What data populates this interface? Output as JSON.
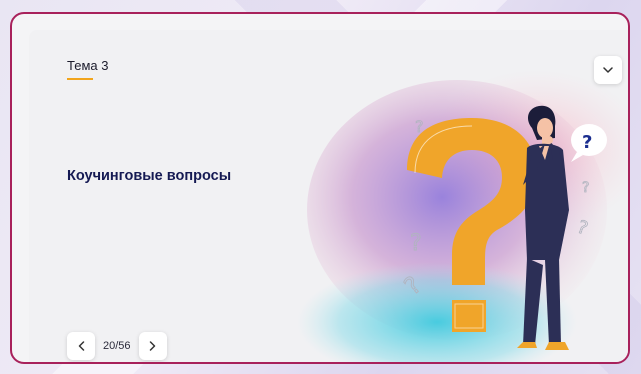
{
  "slide": {
    "topic": "Тема 3",
    "title": "Коучинговые вопросы"
  },
  "navigation": {
    "counter": "20/56",
    "prev_icon": "chevron-left-icon",
    "next_icon": "chevron-right-icon"
  },
  "dropdown": {
    "icon": "chevron-down-icon"
  },
  "illustration": {
    "speech_bubble_text": "?"
  },
  "colors": {
    "frame": "#a8215b",
    "accent": "#f2a51c",
    "title": "#151a53"
  }
}
